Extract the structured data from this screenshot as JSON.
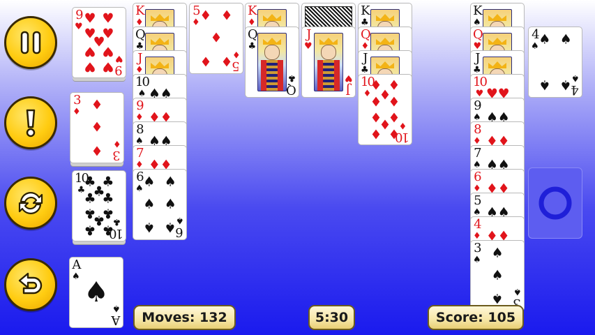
{
  "colors": {
    "red_suit": "#e1141b",
    "black_suit": "#111111",
    "button_gold": "#ffcc11",
    "background_blue": "#1a1aee"
  },
  "toolbar": {
    "buttons": [
      {
        "icon": "pause-icon",
        "label": ""
      },
      {
        "icon": "hint-icon",
        "label": ""
      },
      {
        "icon": "refresh-icon",
        "label": ""
      },
      {
        "icon": "undo-icon",
        "label": ""
      }
    ]
  },
  "reserve": [
    {
      "rank": "9",
      "suit": "♥",
      "color": "red"
    },
    {
      "rank": "3",
      "suit": "♦",
      "color": "red"
    },
    {
      "rank": "10",
      "suit": "♣",
      "color": "black"
    },
    {
      "rank": "A",
      "suit": "♠",
      "color": "black"
    }
  ],
  "tableau1": [
    {
      "rank": "K",
      "suit": "♦",
      "color": "red"
    },
    {
      "rank": "Q",
      "suit": "♣",
      "color": "black"
    },
    {
      "rank": "J",
      "suit": "♦",
      "color": "red"
    },
    {
      "rank": "10",
      "suit": "♠",
      "color": "black"
    },
    {
      "rank": "9",
      "suit": "♦",
      "color": "red"
    },
    {
      "rank": "8",
      "suit": "♠",
      "color": "black"
    },
    {
      "rank": "7",
      "suit": "♦",
      "color": "red"
    },
    {
      "rank": "6",
      "suit": "♠",
      "color": "black"
    }
  ],
  "tableau2": [
    {
      "rank": "5",
      "suit": "♦",
      "color": "red"
    }
  ],
  "tableau3": [
    {
      "rank": "K",
      "suit": "♦",
      "color": "red"
    },
    {
      "rank": "Q",
      "suit": "♣",
      "color": "black"
    }
  ],
  "tableau4": [
    {
      "rank": "J",
      "suit": "♥",
      "color": "red"
    }
  ],
  "tableau5": [
    {
      "rank": "K",
      "suit": "♣",
      "color": "black"
    },
    {
      "rank": "Q",
      "suit": "♦",
      "color": "red"
    },
    {
      "rank": "J",
      "suit": "♣",
      "color": "black"
    },
    {
      "rank": "10",
      "suit": "♦",
      "color": "red"
    }
  ],
  "tableau6": [
    {
      "rank": "K",
      "suit": "♠",
      "color": "black"
    },
    {
      "rank": "Q",
      "suit": "♥",
      "color": "red"
    },
    {
      "rank": "J",
      "suit": "♣",
      "color": "black"
    },
    {
      "rank": "10",
      "suit": "♥",
      "color": "red"
    },
    {
      "rank": "9",
      "suit": "♠",
      "color": "black"
    },
    {
      "rank": "8",
      "suit": "♦",
      "color": "red"
    },
    {
      "rank": "7",
      "suit": "♠",
      "color": "black"
    },
    {
      "rank": "6",
      "suit": "♦",
      "color": "red"
    },
    {
      "rank": "5",
      "suit": "♠",
      "color": "black"
    },
    {
      "rank": "4",
      "suit": "♦",
      "color": "red"
    },
    {
      "rank": "3",
      "suit": "♠",
      "color": "black"
    }
  ],
  "free_card": {
    "rank": "4",
    "suit": "♠",
    "color": "black"
  },
  "empty_slot": {
    "icon": "ring-icon"
  },
  "status": {
    "moves": "Moves: 132",
    "time": "5:30",
    "score": "Score: 105"
  }
}
